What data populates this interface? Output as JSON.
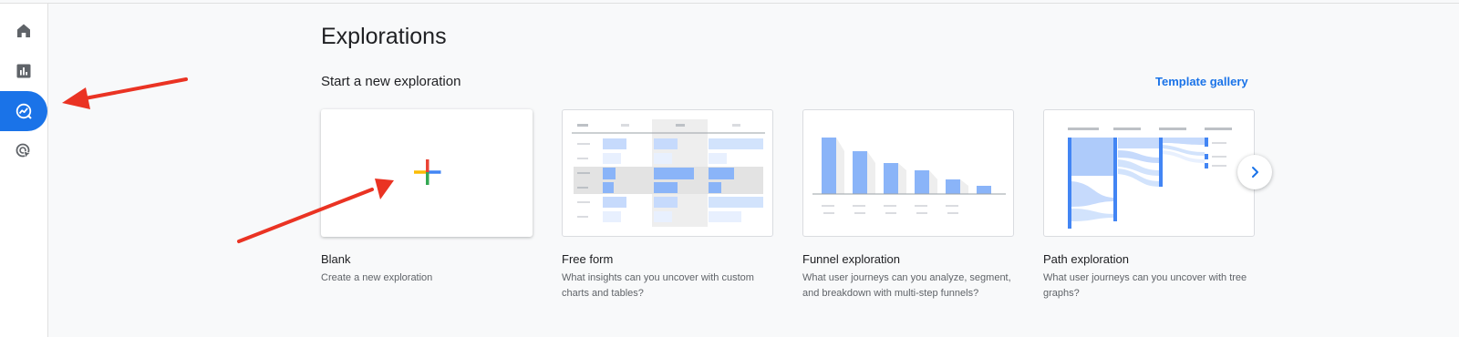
{
  "page": {
    "title": "Explorations"
  },
  "section": {
    "title": "Start a new exploration",
    "template_link": "Template gallery"
  },
  "sidebar": {
    "items": [
      {
        "icon": "home-icon",
        "active": false
      },
      {
        "icon": "reports-icon",
        "active": false
      },
      {
        "icon": "explore-icon",
        "active": true
      },
      {
        "icon": "advertising-icon",
        "active": false
      }
    ]
  },
  "cards": [
    {
      "title": "Blank",
      "description": "Create a new exploration"
    },
    {
      "title": "Free form",
      "description": "What insights can you uncover with custom charts and tables?"
    },
    {
      "title": "Funnel exploration",
      "description": "What user journeys can you analyze, segment, and breakdown with multi-step funnels?"
    },
    {
      "title": "Path exploration",
      "description": "What user journeys can you uncover with tree graphs?"
    }
  ],
  "colors": {
    "accent": "#1a73e8",
    "annotation_arrow": "#ea3323",
    "bar_blue": "#8ab4f8"
  }
}
